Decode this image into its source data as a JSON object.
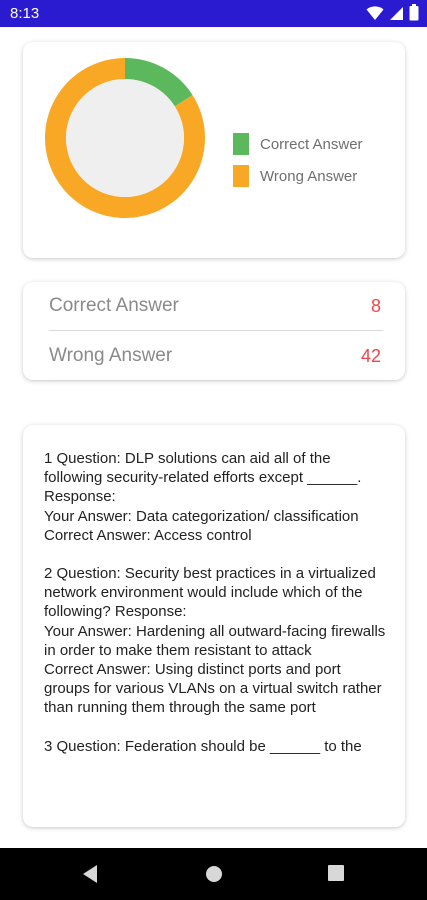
{
  "status_bar": {
    "time": "8:13",
    "icons": [
      "wifi-icon",
      "signal-icon",
      "battery-icon"
    ],
    "background": "#2a1bd1"
  },
  "chart_data": {
    "type": "pie",
    "donut": true,
    "categories": [
      "Correct Answer",
      "Wrong Answer"
    ],
    "values": [
      8,
      42
    ],
    "colors": [
      "#5cb85c",
      "#f9a825"
    ],
    "legend_position": "right"
  },
  "summary": {
    "correct_label": "Correct Answer",
    "correct_value": "8",
    "wrong_label": "Wrong Answer",
    "wrong_value": "42",
    "value_color": "#f2444a"
  },
  "questions": [
    {
      "question": "1 Question: DLP solutions can aid all of the following security-related efforts except ______. Response:",
      "your_answer": "Your Answer: Data categorization/ classification",
      "correct_answer": "Correct Answer: Access control"
    },
    {
      "question": "2 Question: Security best practices in a virtualized network environment would include which of the following? Response:",
      "your_answer": "Your Answer: Hardening all outward-facing firewalls in order to make them resistant to attack",
      "correct_answer": "Correct Answer: Using distinct ports and port groups for various VLANs on a virtual switch rather than running them through the same port"
    },
    {
      "question": "3 Question: Federation should be ______ to the",
      "your_answer": "",
      "correct_answer": ""
    }
  ],
  "nav_bar": {
    "buttons": [
      "back-icon",
      "home-icon",
      "recents-icon"
    ]
  }
}
